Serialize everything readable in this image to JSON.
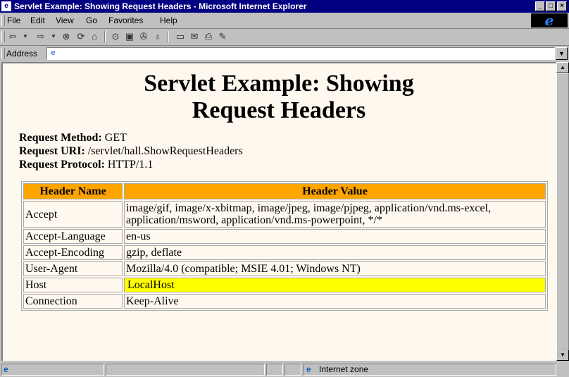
{
  "window": {
    "title": "Servlet Example: Showing Request Headers - Microsoft Internet Explorer",
    "controls": [
      "_",
      "□",
      "×"
    ]
  },
  "menu": [
    "File",
    "Edit",
    "View",
    "Go",
    "Favorites",
    "Help"
  ],
  "address": {
    "label": "Address",
    "value": ""
  },
  "page": {
    "heading_line1": "Servlet Example: Showing",
    "heading_line2": "Request Headers",
    "request_method_label": "Request Method:",
    "request_method": "GET",
    "request_uri_label": "Request URI:",
    "request_uri": "/servlet/hall.ShowRequestHeaders",
    "request_protocol_label": "Request Protocol:",
    "request_protocol": "HTTP/1.1"
  },
  "table": {
    "headers": [
      "Header Name",
      "Header Value"
    ],
    "rows": [
      {
        "name": "Accept",
        "value": "image/gif, image/x-xbitmap, image/jpeg, image/pjpeg, application/vnd.ms-excel, application/msword, application/vnd.ms-powerpoint, */*"
      },
      {
        "name": "Accept-Language",
        "value": "en-us"
      },
      {
        "name": "Accept-Encoding",
        "value": "gzip, deflate"
      },
      {
        "name": "User-Agent",
        "value": "Mozilla/4.0 (compatible; MSIE 4.01; Windows NT)"
      },
      {
        "name": "Host",
        "value": "LocalHost"
      },
      {
        "name": "Connection",
        "value": "Keep-Alive"
      }
    ],
    "highlight_color": "#ffff00",
    "header_color": "#ffa500"
  },
  "status": {
    "zone": "Internet zone"
  },
  "colors": {
    "titlebar": "#000080",
    "page_background": "#fff8ee"
  }
}
